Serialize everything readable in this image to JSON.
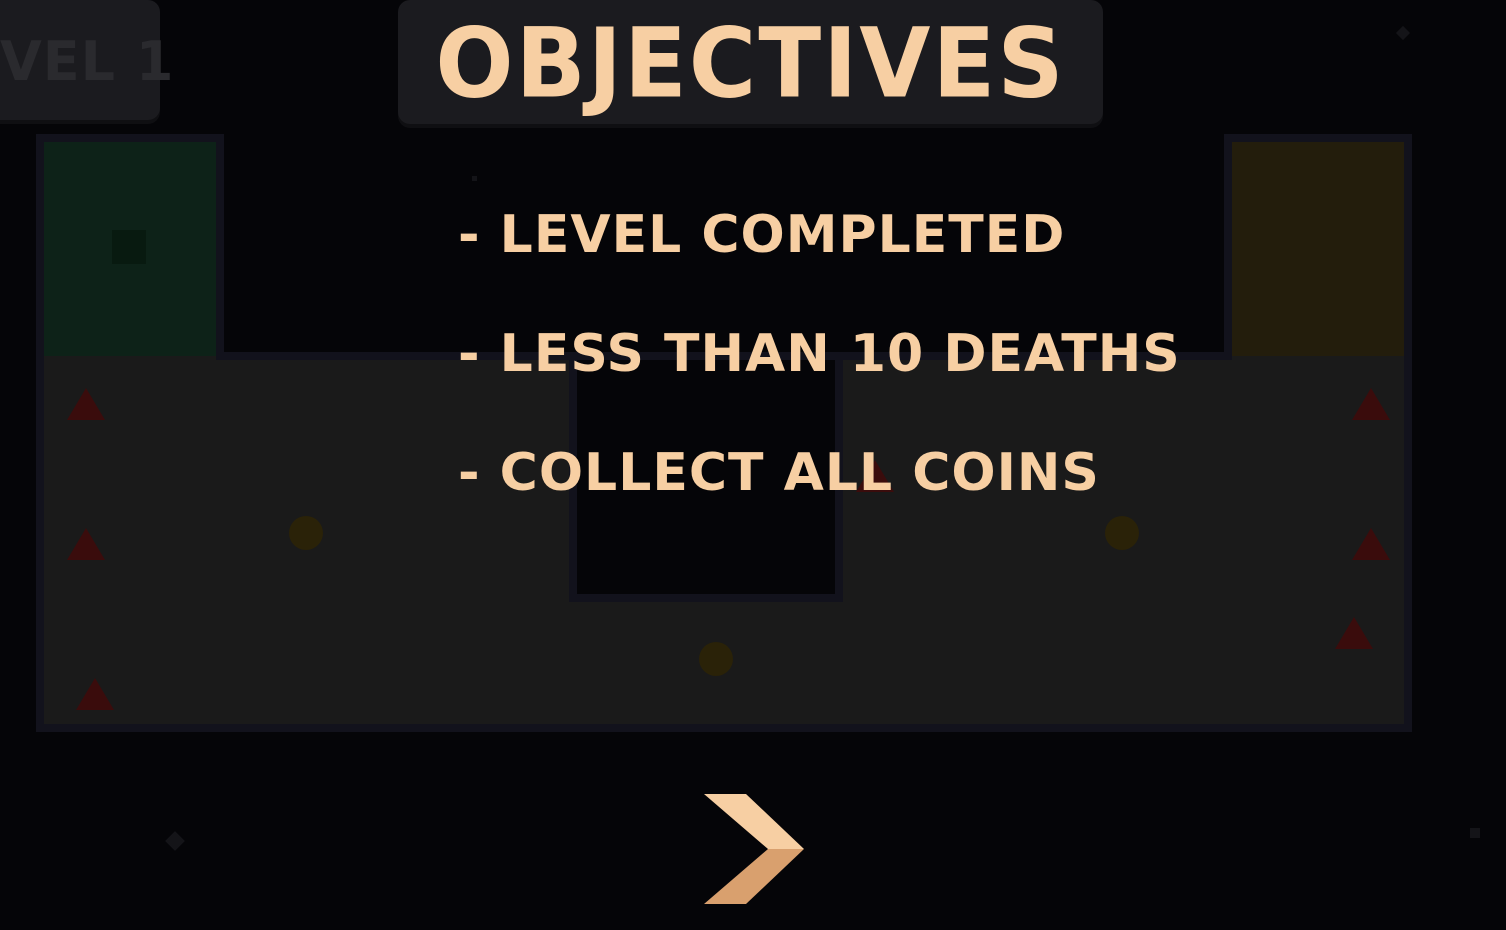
{
  "hud": {
    "level_label": "VEL 1"
  },
  "overlay": {
    "title": "OBJECTIVES",
    "objectives": [
      "- LEVEL COMPLETED",
      "- LESS THAN 10 DEATHS",
      "- COLLECT ALL COINS"
    ]
  },
  "next_button": {
    "icon": "chevron-right-icon"
  },
  "colors": {
    "background": "#050508",
    "floor": "#1a1a1a",
    "wall": "#12121c",
    "start_zone": "#0d2218",
    "goal_zone": "#231d0c",
    "hazard": "#3a0c0c",
    "coin": "#2a2208",
    "text": "#f7cfa3",
    "panel": "#1b1b1f"
  }
}
